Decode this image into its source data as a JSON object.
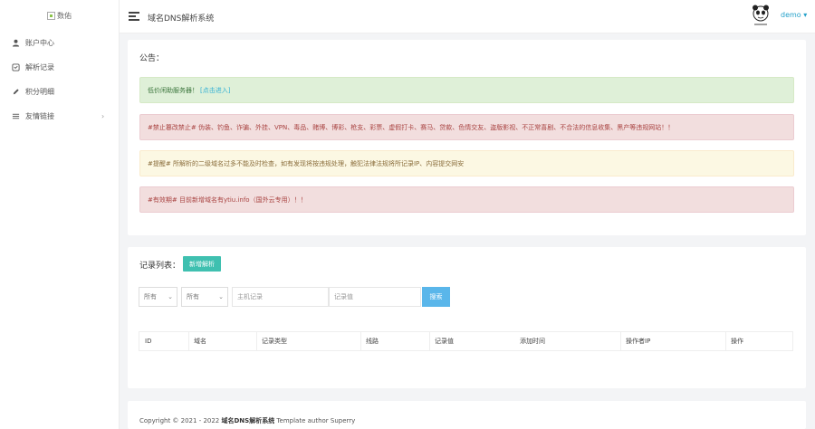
{
  "sidebar": {
    "logo_alt": "数佑",
    "items": [
      {
        "label": "账户中心",
        "icon": "user-icon"
      },
      {
        "label": "解析记录",
        "icon": "record-icon"
      },
      {
        "label": "积分明细",
        "icon": "pencil-icon"
      },
      {
        "label": "友情链接",
        "icon": "list-icon",
        "chevron": "›"
      }
    ]
  },
  "header": {
    "site_title": "域名DNS解析系统",
    "user": "demo ▾"
  },
  "notice": {
    "title": "公告：",
    "alerts": {
      "green_text": "低价闲助服务器！",
      "green_link": "[点击进入]",
      "red1": "#禁止篡改禁止# 伪装、钓鱼、诈骗、外挂、VPN、毒品、赌博、博彩、枪支、彩票、虚假打卡、赛马、贷款、色情交友、盗版影视、不正常喜剧、不合法的信息收集、黑产等违规网站！！",
      "yellow": "#提醒# 所解析的二级域名过多不能及时检查，如有发现将按违规处理，触犯法律法规将所记录IP、内容提交网安",
      "red2": "#有效期# 目前新增域名有ytiu.info（国外云专用）！！"
    }
  },
  "records": {
    "title": "记录列表：",
    "add_button": "新增解析",
    "select1": "所有",
    "select2": "所有",
    "host_placeholder": "主机记录",
    "value_placeholder": "记录值",
    "search_button": "搜索",
    "columns": [
      "ID",
      "域名",
      "记录类型",
      "线路",
      "记录值",
      "添加时间",
      "操作者IP",
      "操作"
    ]
  },
  "footer": {
    "prefix": "Copyright © 2021 - 2022 ",
    "brand": "域名DNS解析系统",
    "suffix": " Template author Superry"
  },
  "colors": {
    "accent": "#26a2ca",
    "add_button": "#3fc0b0",
    "search_button": "#5ab6ea"
  }
}
